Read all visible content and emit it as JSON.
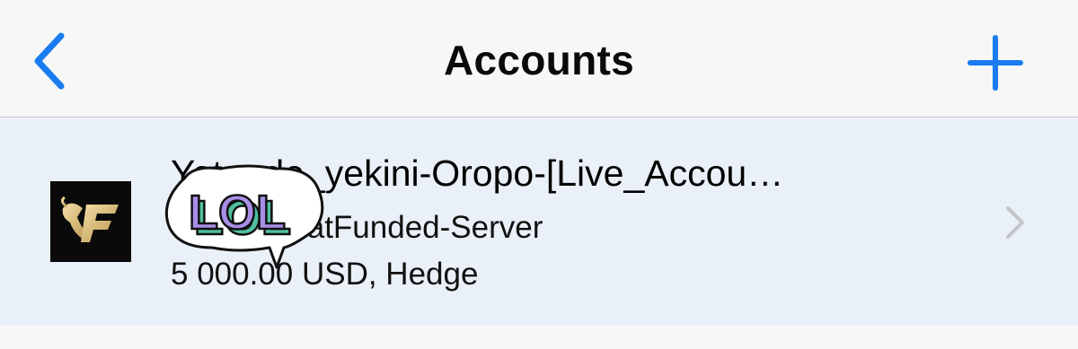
{
  "navbar": {
    "title": "Accounts",
    "back_icon": "chevron-left-icon",
    "add_icon": "plus-icon",
    "accent_color": "#1a7cf0"
  },
  "account": {
    "name": "Yetunde_yekini-Oropo-[Live_Accou…",
    "server_line": "…96 - GoatFunded-Server",
    "balance_line": "5 000.00 USD, Hedge",
    "logo_icon": "goatfunded-logo-icon",
    "chevron_icon": "chevron-right-icon",
    "row_color": "#eaf0f8"
  },
  "sticker": {
    "text": "LOL",
    "colors": {
      "bubble": "#ffffff",
      "text_fill": "#a98ee8",
      "text_shadow": "#4fc0a0"
    }
  }
}
